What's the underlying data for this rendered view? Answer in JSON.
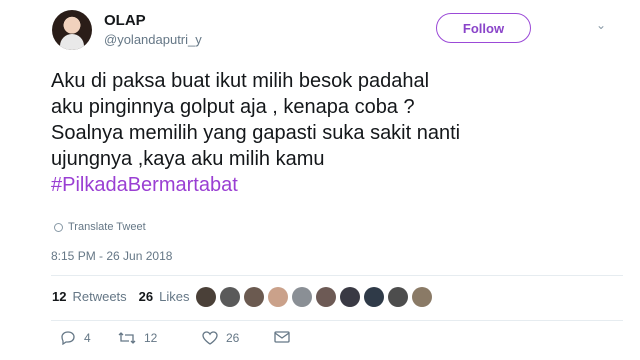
{
  "user": {
    "name": "OLAP",
    "handle": "@yolandaputri_y"
  },
  "follow_label": "Follow",
  "tweet": {
    "lines": [
      "Aku di paksa buat ikut milih besok padahal",
      "aku pinginnya golput aja , kenapa coba ?",
      "Soalnya memilih yang gapasti suka sakit nanti",
      "ujungnya ,kaya aku milih kamu"
    ],
    "hashtag": "#PilkadaBermartabat"
  },
  "translate_label": "Translate Tweet",
  "timestamp": "8:15 PM - 26 Jun 2018",
  "stats": {
    "retweets_count": "12",
    "retweets_label": "Retweets",
    "likes_count": "26",
    "likes_label": "Likes"
  },
  "actions": {
    "reply_count": "4",
    "retweet_count": "12",
    "like_count": "26"
  },
  "colors": {
    "accent": "#9a3fd3",
    "muted": "#657786",
    "text": "#14171a"
  },
  "liker_colors": [
    "#4a4038",
    "#5a5a5a",
    "#6b5a50",
    "#caa18a",
    "#8a8f95",
    "#6d5a55",
    "#3a3a44",
    "#2f3a48",
    "#4d4d4d",
    "#8a7a66"
  ]
}
